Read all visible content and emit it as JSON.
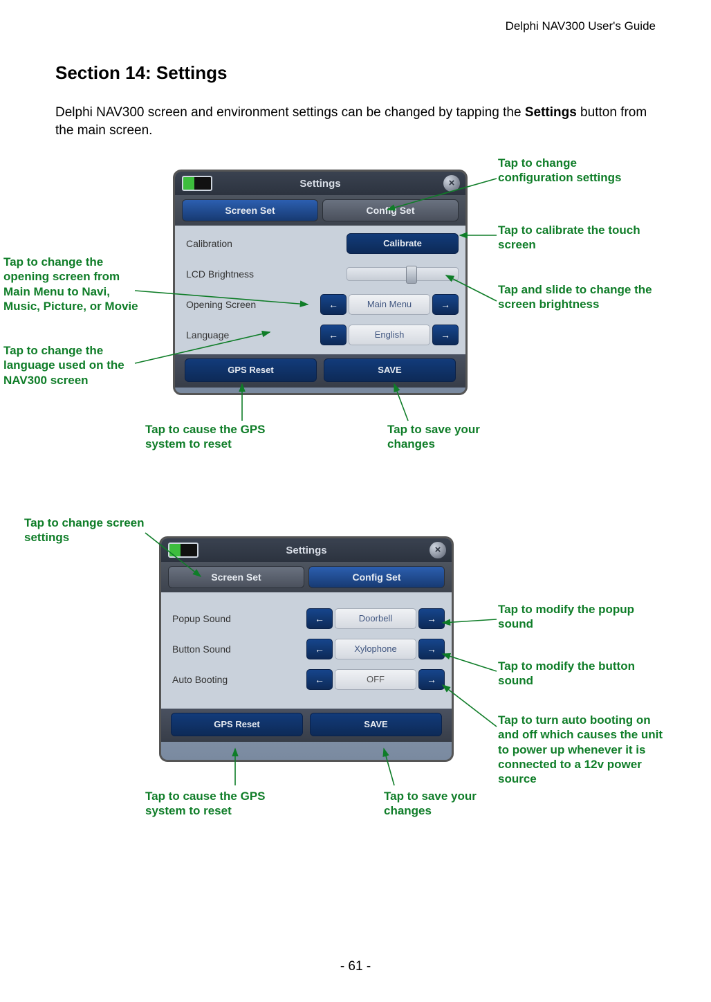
{
  "header": "Delphi NAV300 User's Guide",
  "section_title": "Section 14:     Settings",
  "intro_pre": "Delphi NAV300 screen and environment settings can be changed by tapping the ",
  "intro_bold": "Settings",
  "intro_post": " button from the main screen.",
  "page_number": "- 61 -",
  "device": {
    "title": "Settings",
    "close": "×",
    "tabs": {
      "screen_set": "Screen Set",
      "config_set": "Config Set"
    },
    "screen": {
      "calibration": {
        "label": "Calibration",
        "button": "Calibrate"
      },
      "brightness": {
        "label": "LCD Brightness"
      },
      "opening": {
        "label": "Opening Screen",
        "value": "Main Menu"
      },
      "language": {
        "label": "Language",
        "value": "English"
      }
    },
    "config": {
      "popup": {
        "label": "Popup Sound",
        "value": "Doorbell"
      },
      "button": {
        "label": "Button Sound",
        "value": "Xylophone"
      },
      "auto": {
        "label": "Auto Booting",
        "value": "OFF"
      }
    },
    "arrows": {
      "left": "←",
      "right": "→"
    },
    "buttons": {
      "gps_reset": "GPS Reset",
      "save": "SAVE"
    }
  },
  "callouts": {
    "config_set": "Tap to change configuration settings",
    "calibrate": "Tap to calibrate the touch screen",
    "brightness": "Tap and slide to change the screen brightness",
    "opening": "Tap to change the opening screen from Main Menu to Navi, Music, Picture, or Movie",
    "language": "Tap to change the language used on the NAV300 screen",
    "gps1": "Tap to cause the GPS system to reset",
    "save1": "Tap to save your changes",
    "screen_set": "Tap to change screen settings",
    "popup": "Tap to modify the popup sound",
    "button_sound": "Tap to modify the button sound",
    "auto_boot": "Tap to turn auto booting on and off which causes the unit to power up whenever it is connected to a  12v power source",
    "gps2": "Tap to cause the GPS system to reset",
    "save2": "Tap to save your changes"
  }
}
